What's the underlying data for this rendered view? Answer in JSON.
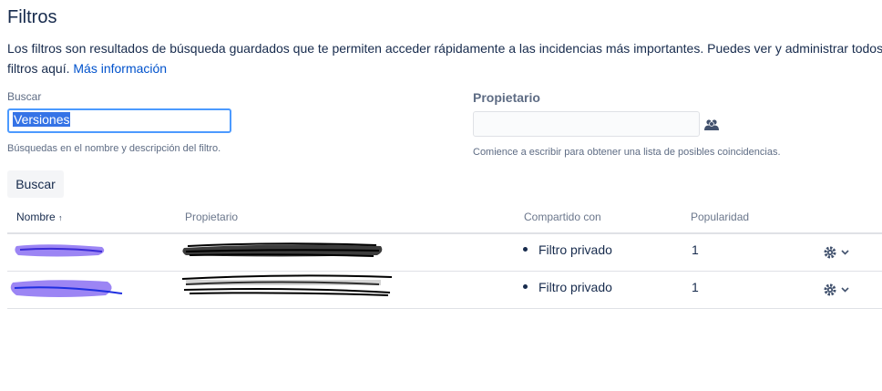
{
  "header": {
    "title": "Filtros",
    "description": "Los filtros son resultados de búsqueda guardados que te permiten acceder rápidamente a las incidencias más importantes. Puedes ver y administrar todos los",
    "description_line2": "filtros aquí.",
    "more_info_link": "Más información"
  },
  "search": {
    "label": "Buscar",
    "value": "Versiones",
    "hint": "Búsquedas en el nombre y descripción del filtro.",
    "button_label": "Buscar"
  },
  "owner": {
    "label": "Propietario",
    "value": "",
    "hint": "Comience a escribir para obtener una lista de posibles coincidencias.",
    "icon": "users-icon"
  },
  "table": {
    "columns": [
      "Nombre",
      "Propietario",
      "Compartido con",
      "Popularidad"
    ],
    "sort_indicator": "↑",
    "rows": [
      {
        "shared_with": "Filtro privado",
        "popularity": "1"
      },
      {
        "shared_with": "Filtro privado",
        "popularity": "1"
      }
    ]
  },
  "colors": {
    "accent": "#0052cc",
    "focus_border": "#4c9aff",
    "redaction_purple": "#7b5cf0",
    "redaction_black": "#111111"
  }
}
